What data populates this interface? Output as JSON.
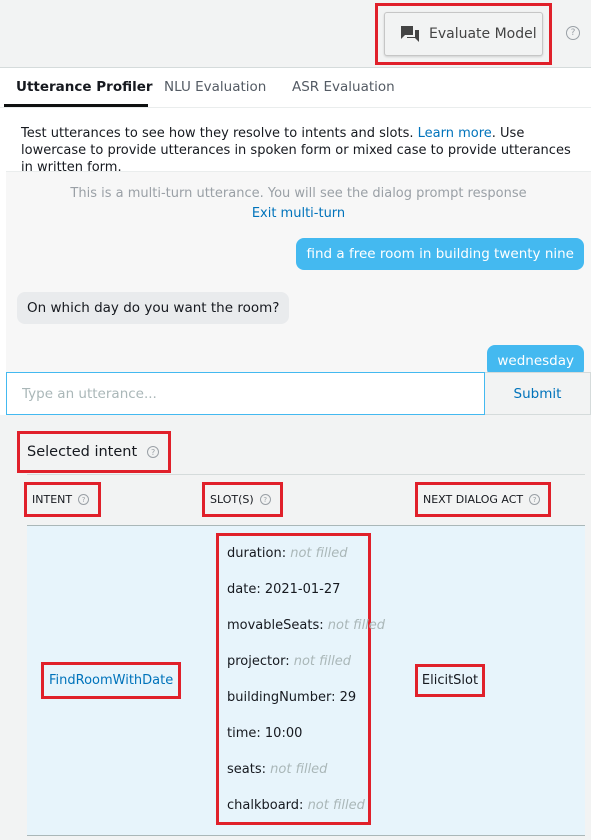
{
  "header": {
    "evaluate_label": "Evaluate Model",
    "help_glyph": "?"
  },
  "tabs": [
    {
      "label": "Utterance Profiler",
      "active": true
    },
    {
      "label": "NLU Evaluation",
      "active": false
    },
    {
      "label": "ASR Evaluation",
      "active": false
    }
  ],
  "intro": {
    "text_before": "Test utterances to see how they resolve to intents and slots. ",
    "link": "Learn more",
    "text_after": ". Use lowercase to provide utterances in spoken form or mixed case to provide utterances in written form."
  },
  "conversation": {
    "multi_turn_note": "This is a multi-turn utterance. You will see the dialog prompt response",
    "exit_link": "Exit multi-turn",
    "messages": [
      {
        "role": "user",
        "text": "find a free room in building twenty nine"
      },
      {
        "role": "bot",
        "text": "On which day do you want the room?"
      },
      {
        "role": "user",
        "text": "wednesday"
      }
    ]
  },
  "input": {
    "placeholder": "Type an utterance...",
    "value": "",
    "submit_label": "Submit"
  },
  "result": {
    "section_title": "Selected intent",
    "columns": {
      "intent": "INTENT",
      "slots": "SLOT(S)",
      "next_dialog_act": "NEXT DIALOG ACT"
    },
    "intent_name": "FindRoomWithDate",
    "next_dialog_act": "ElicitSlot",
    "slots": [
      {
        "name": "duration:",
        "value": "not filled",
        "filled": false
      },
      {
        "name": "date:",
        "value": "2021-01-27",
        "filled": true
      },
      {
        "name": "movableSeats:",
        "value": "not filled",
        "filled": false
      },
      {
        "name": "projector:",
        "value": "not filled",
        "filled": false
      },
      {
        "name": "buildingNumber:",
        "value": "29",
        "filled": true
      },
      {
        "name": "time:",
        "value": "10:00",
        "filled": true
      },
      {
        "name": "seats:",
        "value": "not filled",
        "filled": false
      },
      {
        "name": "chalkboard:",
        "value": "not filled",
        "filled": false
      }
    ]
  },
  "colors": {
    "accent": "#0073bb",
    "user_bubble": "#44b9f0",
    "highlight": "#e0202a"
  },
  "icons": {
    "evaluate": "chat-bubbles-icon",
    "help": "help-circle-icon"
  }
}
